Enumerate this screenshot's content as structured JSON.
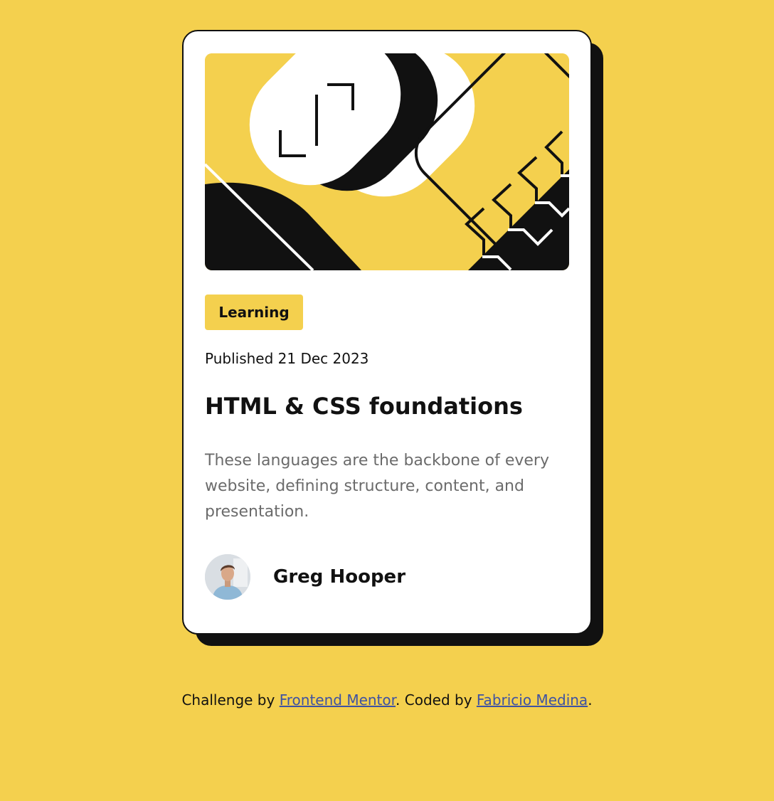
{
  "card": {
    "tag": "Learning",
    "published": "Published 21 Dec 2023",
    "title": "HTML & CSS foundations",
    "description": "These languages are the backbone of every website, defining structure, content, and presentation.",
    "author": {
      "name": "Greg Hooper",
      "avatar_icon": "person-avatar-icon"
    },
    "hero_icon": "abstract-illustration-icon"
  },
  "footer": {
    "prefix": "Challenge by ",
    "link1": "Frontend Mentor",
    "middle": ". Coded by ",
    "link2": "Fabricio Medina",
    "suffix": "."
  },
  "colors": {
    "background": "#F4D04E",
    "card": "#FFFFFF",
    "ink": "#111111",
    "muted_text": "#6B6B6B",
    "link": "#3E52A3"
  }
}
